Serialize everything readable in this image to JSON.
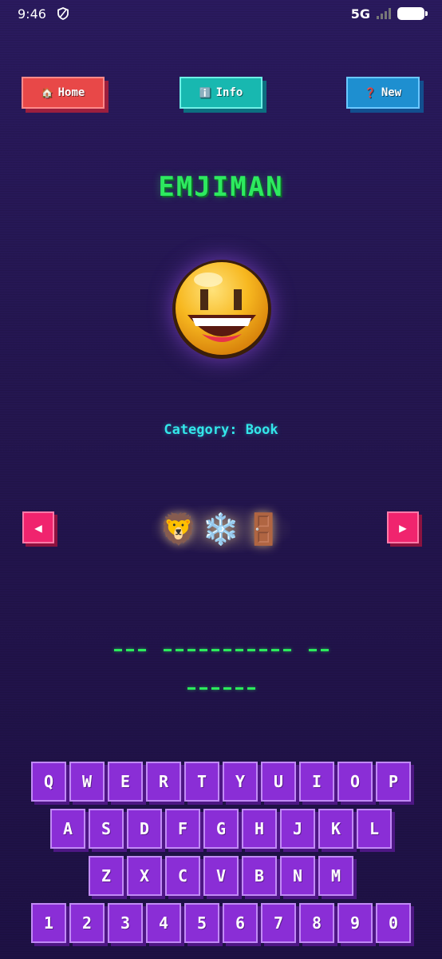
{
  "status_bar": {
    "time": "9:46",
    "network": "5G",
    "icons": [
      "shield-icon",
      "signal-icon",
      "battery-icon"
    ]
  },
  "nav": {
    "home": {
      "icon": "🏠",
      "label": "Home"
    },
    "info": {
      "icon": "ℹ️",
      "label": "Info"
    },
    "new": {
      "icon": "❓",
      "label": "New"
    }
  },
  "title": "EMJIMAN",
  "category": {
    "text": "Category: Book"
  },
  "clue": {
    "emojis": [
      "🦁",
      "❄️",
      "🚪"
    ],
    "prev_icon": "◀",
    "next_icon": "▶"
  },
  "puzzle": {
    "words": [
      3,
      11,
      2,
      6
    ]
  },
  "keyboard": {
    "rows": [
      [
        "Q",
        "W",
        "E",
        "R",
        "T",
        "Y",
        "U",
        "I",
        "O",
        "P"
      ],
      [
        "A",
        "S",
        "D",
        "F",
        "G",
        "H",
        "J",
        "K",
        "L"
      ],
      [
        "Z",
        "X",
        "C",
        "V",
        "B",
        "N",
        "M"
      ],
      [
        "1",
        "2",
        "3",
        "4",
        "5",
        "6",
        "7",
        "8",
        "9",
        "0"
      ]
    ]
  },
  "colors": {
    "background": "#241650",
    "title": "#2dea5f",
    "category": "#33e6ea",
    "key": "#8a2ed6",
    "home": "#e84848",
    "info": "#18b8b0",
    "new": "#1e8fd0",
    "arrow": "#f0246e"
  }
}
